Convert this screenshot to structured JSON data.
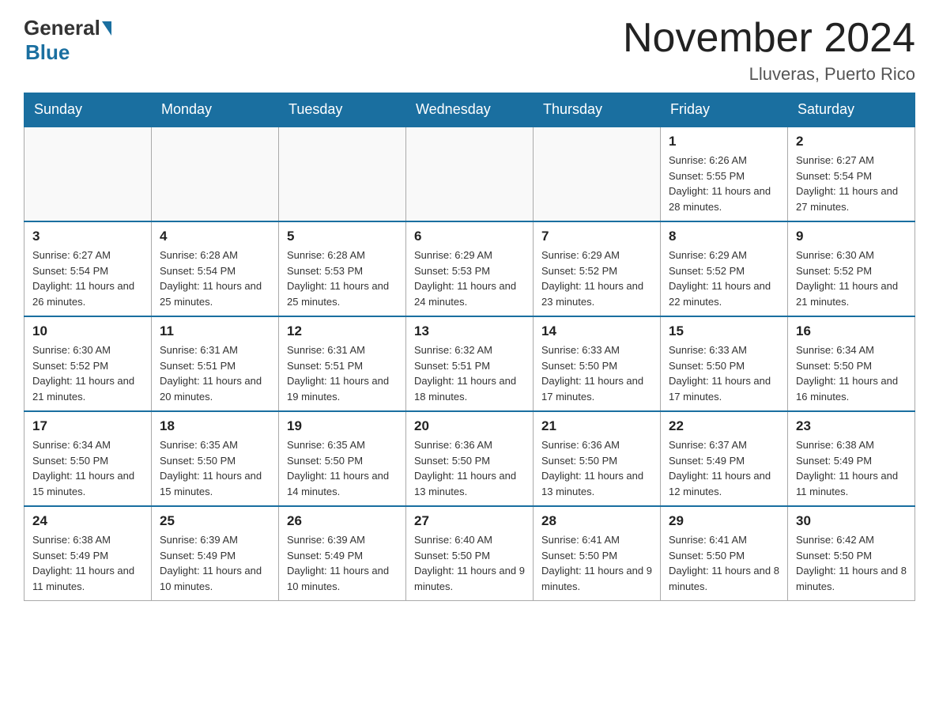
{
  "header": {
    "logo_general": "General",
    "logo_blue": "Blue",
    "month_title": "November 2024",
    "location": "Lluveras, Puerto Rico"
  },
  "days_of_week": [
    "Sunday",
    "Monday",
    "Tuesday",
    "Wednesday",
    "Thursday",
    "Friday",
    "Saturday"
  ],
  "weeks": [
    [
      {
        "day": "",
        "info": ""
      },
      {
        "day": "",
        "info": ""
      },
      {
        "day": "",
        "info": ""
      },
      {
        "day": "",
        "info": ""
      },
      {
        "day": "",
        "info": ""
      },
      {
        "day": "1",
        "info": "Sunrise: 6:26 AM\nSunset: 5:55 PM\nDaylight: 11 hours and 28 minutes."
      },
      {
        "day": "2",
        "info": "Sunrise: 6:27 AM\nSunset: 5:54 PM\nDaylight: 11 hours and 27 minutes."
      }
    ],
    [
      {
        "day": "3",
        "info": "Sunrise: 6:27 AM\nSunset: 5:54 PM\nDaylight: 11 hours and 26 minutes."
      },
      {
        "day": "4",
        "info": "Sunrise: 6:28 AM\nSunset: 5:54 PM\nDaylight: 11 hours and 25 minutes."
      },
      {
        "day": "5",
        "info": "Sunrise: 6:28 AM\nSunset: 5:53 PM\nDaylight: 11 hours and 25 minutes."
      },
      {
        "day": "6",
        "info": "Sunrise: 6:29 AM\nSunset: 5:53 PM\nDaylight: 11 hours and 24 minutes."
      },
      {
        "day": "7",
        "info": "Sunrise: 6:29 AM\nSunset: 5:52 PM\nDaylight: 11 hours and 23 minutes."
      },
      {
        "day": "8",
        "info": "Sunrise: 6:29 AM\nSunset: 5:52 PM\nDaylight: 11 hours and 22 minutes."
      },
      {
        "day": "9",
        "info": "Sunrise: 6:30 AM\nSunset: 5:52 PM\nDaylight: 11 hours and 21 minutes."
      }
    ],
    [
      {
        "day": "10",
        "info": "Sunrise: 6:30 AM\nSunset: 5:52 PM\nDaylight: 11 hours and 21 minutes."
      },
      {
        "day": "11",
        "info": "Sunrise: 6:31 AM\nSunset: 5:51 PM\nDaylight: 11 hours and 20 minutes."
      },
      {
        "day": "12",
        "info": "Sunrise: 6:31 AM\nSunset: 5:51 PM\nDaylight: 11 hours and 19 minutes."
      },
      {
        "day": "13",
        "info": "Sunrise: 6:32 AM\nSunset: 5:51 PM\nDaylight: 11 hours and 18 minutes."
      },
      {
        "day": "14",
        "info": "Sunrise: 6:33 AM\nSunset: 5:50 PM\nDaylight: 11 hours and 17 minutes."
      },
      {
        "day": "15",
        "info": "Sunrise: 6:33 AM\nSunset: 5:50 PM\nDaylight: 11 hours and 17 minutes."
      },
      {
        "day": "16",
        "info": "Sunrise: 6:34 AM\nSunset: 5:50 PM\nDaylight: 11 hours and 16 minutes."
      }
    ],
    [
      {
        "day": "17",
        "info": "Sunrise: 6:34 AM\nSunset: 5:50 PM\nDaylight: 11 hours and 15 minutes."
      },
      {
        "day": "18",
        "info": "Sunrise: 6:35 AM\nSunset: 5:50 PM\nDaylight: 11 hours and 15 minutes."
      },
      {
        "day": "19",
        "info": "Sunrise: 6:35 AM\nSunset: 5:50 PM\nDaylight: 11 hours and 14 minutes."
      },
      {
        "day": "20",
        "info": "Sunrise: 6:36 AM\nSunset: 5:50 PM\nDaylight: 11 hours and 13 minutes."
      },
      {
        "day": "21",
        "info": "Sunrise: 6:36 AM\nSunset: 5:50 PM\nDaylight: 11 hours and 13 minutes."
      },
      {
        "day": "22",
        "info": "Sunrise: 6:37 AM\nSunset: 5:49 PM\nDaylight: 11 hours and 12 minutes."
      },
      {
        "day": "23",
        "info": "Sunrise: 6:38 AM\nSunset: 5:49 PM\nDaylight: 11 hours and 11 minutes."
      }
    ],
    [
      {
        "day": "24",
        "info": "Sunrise: 6:38 AM\nSunset: 5:49 PM\nDaylight: 11 hours and 11 minutes."
      },
      {
        "day": "25",
        "info": "Sunrise: 6:39 AM\nSunset: 5:49 PM\nDaylight: 11 hours and 10 minutes."
      },
      {
        "day": "26",
        "info": "Sunrise: 6:39 AM\nSunset: 5:49 PM\nDaylight: 11 hours and 10 minutes."
      },
      {
        "day": "27",
        "info": "Sunrise: 6:40 AM\nSunset: 5:50 PM\nDaylight: 11 hours and 9 minutes."
      },
      {
        "day": "28",
        "info": "Sunrise: 6:41 AM\nSunset: 5:50 PM\nDaylight: 11 hours and 9 minutes."
      },
      {
        "day": "29",
        "info": "Sunrise: 6:41 AM\nSunset: 5:50 PM\nDaylight: 11 hours and 8 minutes."
      },
      {
        "day": "30",
        "info": "Sunrise: 6:42 AM\nSunset: 5:50 PM\nDaylight: 11 hours and 8 minutes."
      }
    ]
  ]
}
